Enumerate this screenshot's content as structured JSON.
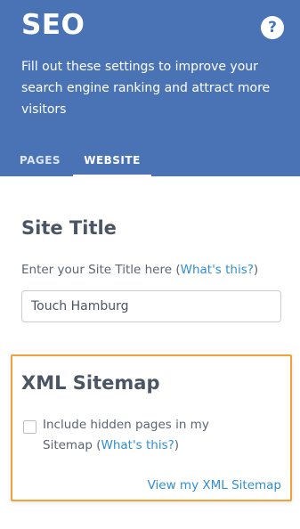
{
  "header": {
    "title": "SEO",
    "help_label": "?",
    "subtitle": "Fill out these settings to improve your search engine ranking and attract more visitors",
    "tabs": [
      {
        "label": "PAGES",
        "active": false
      },
      {
        "label": "WEBSITE",
        "active": true
      }
    ],
    "background_color": "#4a73b5"
  },
  "site_title": {
    "heading": "Site Title",
    "instruction": "Enter your Site Title here (",
    "whats_this": "What's this?",
    "close_paren": ")",
    "value": "Touch Hamburg"
  },
  "sitemap": {
    "heading": "XML Sitemap",
    "checkbox_label_prefix": "Include hidden pages in my Sitemap (",
    "whats_this": "What's this?",
    "close_paren": ")",
    "checked": false,
    "view_link": "View my XML Sitemap",
    "highlight_color": "#f2a23a"
  },
  "link_color": "#2f8fd3"
}
